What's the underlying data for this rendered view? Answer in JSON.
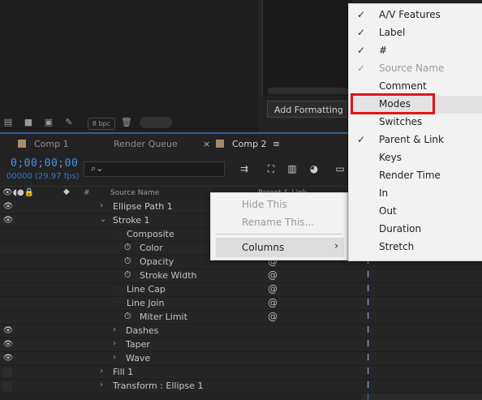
{
  "project_panel": {
    "add_formatting": "Add Formatting",
    "bpc": "8 bpc"
  },
  "tabs": {
    "comp1": "Comp 1",
    "render_queue": "Render Queue",
    "close_glyph": "×",
    "comp2": "Comp 2",
    "menu_glyph": "≡"
  },
  "timeline": {
    "timecode": "0;00;00;00",
    "fps": "00000 (29.97 fps)",
    "col_hash": "#",
    "col_source_name": "Source Name",
    "col_parent_link": "Parent & Link"
  },
  "layers": [
    {
      "label": "Ellipse Path 1",
      "indent": 1,
      "eye": true,
      "arrow": "›",
      "stopwatch": false,
      "link": false
    },
    {
      "label": "Stroke 1",
      "indent": 1,
      "eye": true,
      "arrow": "⌄",
      "stopwatch": false,
      "link": false
    },
    {
      "label": "Composite",
      "indent": 2,
      "eye": false,
      "arrow": "",
      "stopwatch": false,
      "link": false
    },
    {
      "label": "Color",
      "indent": 3,
      "eye": false,
      "arrow": "",
      "stopwatch": true,
      "link": true
    },
    {
      "label": "Opacity",
      "indent": 3,
      "eye": false,
      "arrow": "",
      "stopwatch": true,
      "link": true
    },
    {
      "label": "Stroke Width",
      "indent": 3,
      "eye": false,
      "arrow": "",
      "stopwatch": true,
      "link": true
    },
    {
      "label": "Line Cap",
      "indent": 2,
      "eye": false,
      "arrow": "",
      "stopwatch": false,
      "link": true
    },
    {
      "label": "Line Join",
      "indent": 2,
      "eye": false,
      "arrow": "",
      "stopwatch": false,
      "link": true
    },
    {
      "label": "Miter Limit",
      "indent": 3,
      "eye": false,
      "arrow": "",
      "stopwatch": true,
      "link": true
    },
    {
      "label": "Dashes",
      "indent": 2,
      "eye": true,
      "arrow": "›",
      "stopwatch": false,
      "link": false
    },
    {
      "label": "Taper",
      "indent": 2,
      "eye": true,
      "arrow": "›",
      "stopwatch": false,
      "link": false
    },
    {
      "label": "Wave",
      "indent": 2,
      "eye": true,
      "arrow": "›",
      "stopwatch": false,
      "link": false
    },
    {
      "label": "Fill 1",
      "indent": 1,
      "eye": false,
      "arrow": "›",
      "stopwatch": false,
      "link": false
    },
    {
      "label": "Transform : Ellipse 1",
      "indent": 1,
      "eye": false,
      "arrow": "›",
      "stopwatch": false,
      "link": false
    }
  ],
  "context_menu": {
    "hide_this": "Hide This",
    "rename_this": "Rename This...",
    "columns": "Columns",
    "submenu_arrow": "›"
  },
  "columns_menu": [
    {
      "label": "A/V Features",
      "checked": true,
      "disabled": false
    },
    {
      "label": "Label",
      "checked": true,
      "disabled": false
    },
    {
      "label": "#",
      "checked": true,
      "disabled": false
    },
    {
      "label": "Source Name",
      "checked": true,
      "disabled": true
    },
    {
      "label": "Comment",
      "checked": false,
      "disabled": false
    },
    {
      "label": "Modes",
      "checked": false,
      "disabled": false
    },
    {
      "label": "Switches",
      "checked": false,
      "disabled": false
    },
    {
      "label": "Parent & Link",
      "checked": true,
      "disabled": false
    },
    {
      "label": "Keys",
      "checked": false,
      "disabled": false
    },
    {
      "label": "Render Time",
      "checked": false,
      "disabled": false
    },
    {
      "label": "In",
      "checked": false,
      "disabled": false
    },
    {
      "label": "Out",
      "checked": false,
      "disabled": false
    },
    {
      "label": "Duration",
      "checked": false,
      "disabled": false
    },
    {
      "label": "Stretch",
      "checked": false,
      "disabled": false
    }
  ],
  "highlight": {
    "target": "Modes",
    "color": "#e01515"
  }
}
